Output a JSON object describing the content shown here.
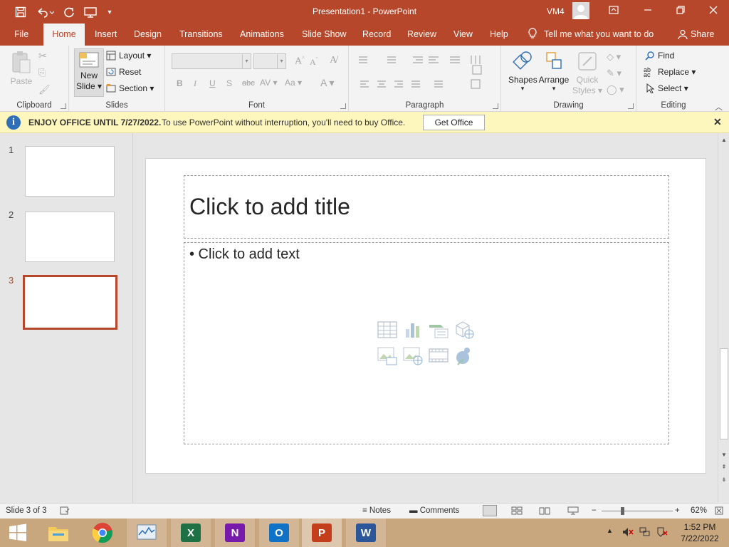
{
  "titlebar": {
    "document_title": "Presentation1  -  PowerPoint",
    "user": "VM4",
    "icons": [
      "save-icon",
      "undo-icon",
      "redo-icon",
      "present-icon",
      "customize-qat-icon",
      "ribbon-display-icon",
      "minimize-icon",
      "restore-icon",
      "close-icon"
    ]
  },
  "tabs": [
    "File",
    "Home",
    "Insert",
    "Design",
    "Transitions",
    "Animations",
    "Slide Show",
    "Record",
    "Review",
    "View",
    "Help"
  ],
  "active_tab": "Home",
  "tell_me": "Tell me what you want to do",
  "share": "Share",
  "ribbon": {
    "clipboard": {
      "label": "Clipboard",
      "paste": "Paste"
    },
    "slides": {
      "label": "Slides",
      "new_slide_1": "New",
      "new_slide_2": "Slide",
      "layout": "Layout",
      "reset": "Reset",
      "section": "Section"
    },
    "font": {
      "label": "Font"
    },
    "paragraph": {
      "label": "Paragraph"
    },
    "drawing": {
      "label": "Drawing",
      "shapes": "Shapes",
      "arrange": "Arrange",
      "quick_styles_1": "Quick",
      "quick_styles_2": "Styles"
    },
    "editing": {
      "label": "Editing",
      "find": "Find",
      "replace": "Replace",
      "select": "Select"
    }
  },
  "infobar": {
    "bold_text": "ENJOY OFFICE UNTIL 7/27/2022.",
    "text": "To use PowerPoint without interruption, you'll need to buy Office.",
    "button": "Get Office"
  },
  "thumbnails": [
    {
      "num": "1"
    },
    {
      "num": "2"
    },
    {
      "num": "3"
    }
  ],
  "current_slide": 3,
  "slide": {
    "title_placeholder": "Click to add title",
    "body_placeholder": "• Click to add text"
  },
  "status": {
    "slide_info": "Slide 3 of 3",
    "notes": "Notes",
    "comments": "Comments",
    "zoom": "62%"
  },
  "taskbar": {
    "apps": [
      "start",
      "file-explorer",
      "chrome",
      "task-manager",
      "excel",
      "onenote",
      "outlook",
      "powerpoint",
      "word"
    ],
    "time": "1:52 PM",
    "date": "7/22/2022"
  },
  "colors": {
    "accent": "#b7472a",
    "infobar": "#fdf6bd",
    "taskbar": "#c8a77e"
  }
}
